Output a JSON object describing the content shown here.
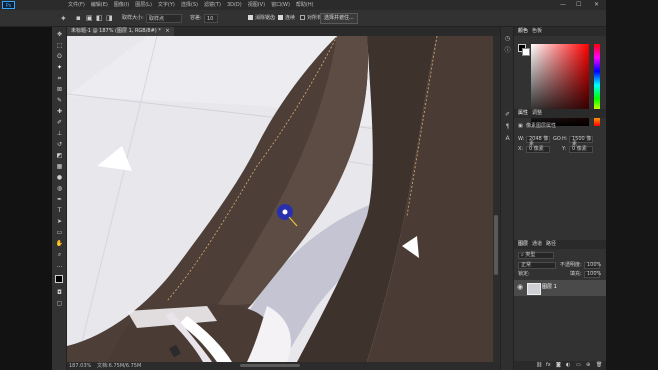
{
  "app": {
    "logo_text": "Ps"
  },
  "menus": [
    "文件(F)",
    "编辑(E)",
    "图像(I)",
    "图层(L)",
    "文字(Y)",
    "选择(S)",
    "滤镜(T)",
    "3D(D)",
    "视图(V)",
    "窗口(W)",
    "帮助(H)"
  ],
  "window_controls": {
    "minimize": "—",
    "maximize": "☐",
    "close": "✕"
  },
  "options_bar": {
    "style_label": "取样大小:",
    "style_value": "取样点",
    "tolerance_label": "容差:",
    "tolerance_value": "10",
    "antialias_label": "消除锯齿",
    "contiguous_label": "连续",
    "all_layers_label": "对所有图层取样",
    "select_subject_button": "选择并遮住..."
  },
  "document_tab": {
    "title": "未标题-1 @ 187% (图层 1, RGB/8#) *",
    "close": "×"
  },
  "status_bar": {
    "zoom": "187.03%",
    "doc_info": "文档:6.75M/6.75M"
  },
  "panels": {
    "color": {
      "tabs": [
        "颜色",
        "色板"
      ],
      "foreground_color": "#000000",
      "background_color": "#ffffff",
      "hue_marker_color": "#e03030"
    },
    "properties": {
      "tabs": [
        "属性",
        "调整"
      ],
      "title": "像素图层属性",
      "w_label": "W:",
      "w_value": "2048 像素",
      "go_label": "GO",
      "h_label": "H:",
      "h_value": "1500 像素",
      "x_label": "X:",
      "x_value": "0 像素",
      "y_label": "Y:",
      "y_value": "0 像素"
    },
    "layers": {
      "tabs": [
        "图层",
        "通道",
        "路径"
      ],
      "filter_value": "类型",
      "blend_mode": "正常",
      "opacity_label": "不透明度:",
      "opacity_value": "100%",
      "lock_label": "锁定:",
      "fill_label": "填充:",
      "fill_value": "100%",
      "layer_name": "图层 1"
    }
  },
  "colors": {
    "accent": "#31a8ff",
    "cursor_ring": "#1e2bbf"
  }
}
